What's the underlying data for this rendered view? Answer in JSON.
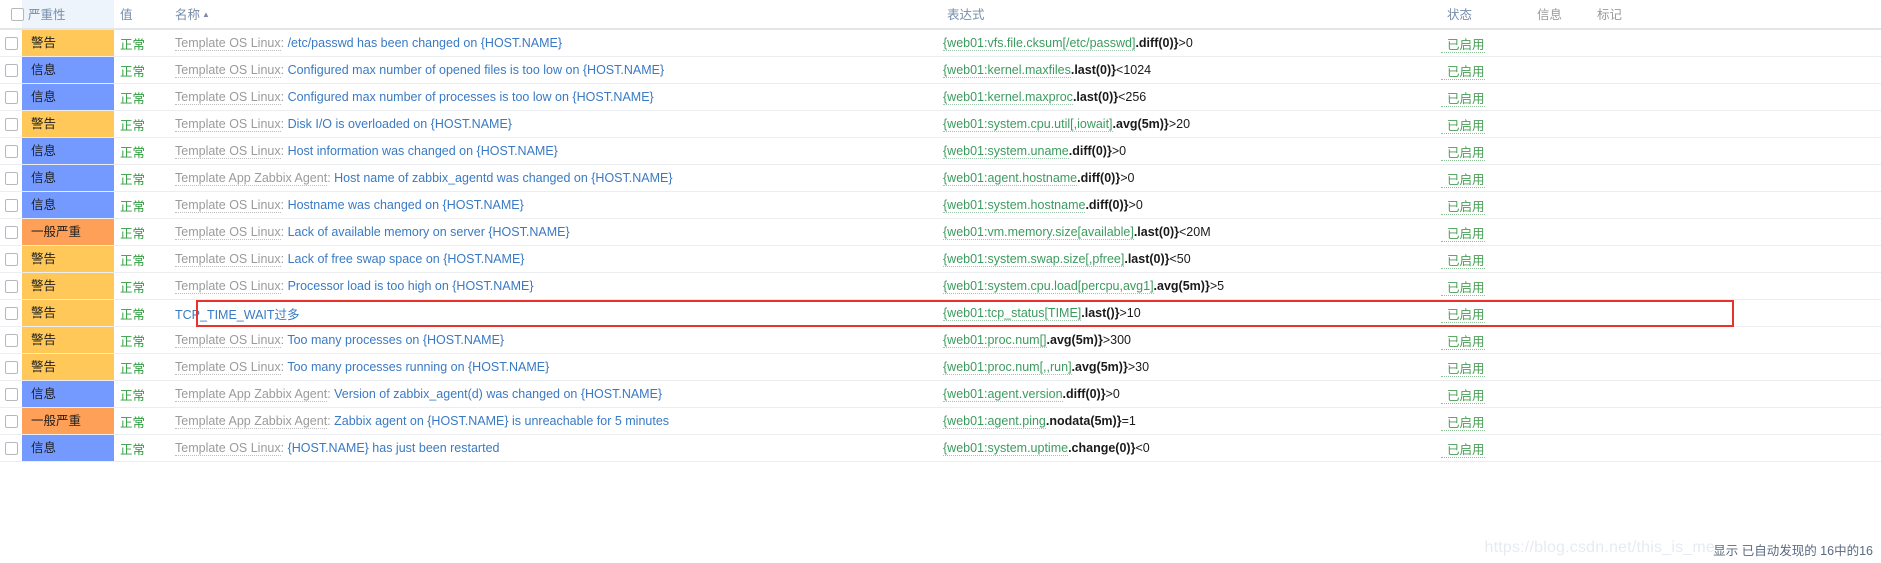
{
  "table": {
    "columns": {
      "severity": "严重性",
      "value": "值",
      "name": "名称",
      "name_sort_arrow": "▲",
      "expression": "表达式",
      "status": "状态",
      "info": "信息",
      "tag": "标记"
    },
    "rows": [
      {
        "severity": "警告",
        "severity_class": "sev-warning",
        "value": "正常",
        "template": "Template OS Linux",
        "trigger": "/etc/passwd has been changed on {HOST.NAME}",
        "expr_key": "{web01:vfs.file.cksum[/etc/passwd]",
        "expr_fn": ".diff(0)}",
        "expr_op": ">0",
        "status": "已启用",
        "info": "",
        "tag": ""
      },
      {
        "severity": "信息",
        "severity_class": "sev-info",
        "value": "正常",
        "template": "Template OS Linux",
        "trigger": "Configured max number of opened files is too low on {HOST.NAME}",
        "expr_key": "{web01:kernel.maxfiles",
        "expr_fn": ".last(0)}",
        "expr_op": "<1024",
        "status": "已启用",
        "info": "",
        "tag": ""
      },
      {
        "severity": "信息",
        "severity_class": "sev-info",
        "value": "正常",
        "template": "Template OS Linux",
        "trigger": "Configured max number of processes is too low on {HOST.NAME}",
        "expr_key": "{web01:kernel.maxproc",
        "expr_fn": ".last(0)}",
        "expr_op": "<256",
        "status": "已启用",
        "info": "",
        "tag": ""
      },
      {
        "severity": "警告",
        "severity_class": "sev-warning",
        "value": "正常",
        "template": "Template OS Linux",
        "trigger": "Disk I/O is overloaded on {HOST.NAME}",
        "expr_key": "{web01:system.cpu.util[,iowait]",
        "expr_fn": ".avg(5m)}",
        "expr_op": ">20",
        "status": "已启用",
        "info": "",
        "tag": ""
      },
      {
        "severity": "信息",
        "severity_class": "sev-info",
        "value": "正常",
        "template": "Template OS Linux",
        "trigger": "Host information was changed on {HOST.NAME}",
        "expr_key": "{web01:system.uname",
        "expr_fn": ".diff(0)}",
        "expr_op": ">0",
        "status": "已启用",
        "info": "",
        "tag": ""
      },
      {
        "severity": "信息",
        "severity_class": "sev-info",
        "value": "正常",
        "template": "Template App Zabbix Agent",
        "trigger": "Host name of zabbix_agentd was changed on {HOST.NAME}",
        "expr_key": "{web01:agent.hostname",
        "expr_fn": ".diff(0)}",
        "expr_op": ">0",
        "status": "已启用",
        "info": "",
        "tag": ""
      },
      {
        "severity": "信息",
        "severity_class": "sev-info",
        "value": "正常",
        "template": "Template OS Linux",
        "trigger": "Hostname was changed on {HOST.NAME}",
        "expr_key": "{web01:system.hostname",
        "expr_fn": ".diff(0)}",
        "expr_op": ">0",
        "status": "已启用",
        "info": "",
        "tag": ""
      },
      {
        "severity": "一般严重",
        "severity_class": "sev-average",
        "value": "正常",
        "template": "Template OS Linux",
        "trigger": "Lack of available memory on server {HOST.NAME}",
        "expr_key": "{web01:vm.memory.size[available]",
        "expr_fn": ".last(0)}",
        "expr_op": "<20M",
        "status": "已启用",
        "info": "",
        "tag": ""
      },
      {
        "severity": "警告",
        "severity_class": "sev-warning",
        "value": "正常",
        "template": "Template OS Linux",
        "trigger": "Lack of free swap space on {HOST.NAME}",
        "expr_key": "{web01:system.swap.size[,pfree]",
        "expr_fn": ".last(0)}",
        "expr_op": "<50",
        "status": "已启用",
        "info": "",
        "tag": ""
      },
      {
        "severity": "警告",
        "severity_class": "sev-warning",
        "value": "正常",
        "template": "Template OS Linux",
        "trigger": "Processor load is too high on {HOST.NAME}",
        "expr_key": "{web01:system.cpu.load[percpu,avg1]",
        "expr_fn": ".avg(5m)}",
        "expr_op": ">5",
        "status": "已启用",
        "info": "",
        "tag": ""
      },
      {
        "severity": "警告",
        "severity_class": "sev-warning",
        "value": "正常",
        "template": "",
        "trigger": "TCP_TIME_WAIT过多",
        "expr_key": "{web01:tcp_status[TIME]",
        "expr_fn": ".last()}",
        "expr_op": ">10",
        "status": "已启用",
        "info": "",
        "tag": "",
        "highlighted": true
      },
      {
        "severity": "警告",
        "severity_class": "sev-warning",
        "value": "正常",
        "template": "Template OS Linux",
        "trigger": "Too many processes on {HOST.NAME}",
        "expr_key": "{web01:proc.num[]",
        "expr_fn": ".avg(5m)}",
        "expr_op": ">300",
        "status": "已启用",
        "info": "",
        "tag": ""
      },
      {
        "severity": "警告",
        "severity_class": "sev-warning",
        "value": "正常",
        "template": "Template OS Linux",
        "trigger": "Too many processes running on {HOST.NAME}",
        "expr_key": "{web01:proc.num[,,run]",
        "expr_fn": ".avg(5m)}",
        "expr_op": ">30",
        "status": "已启用",
        "info": "",
        "tag": ""
      },
      {
        "severity": "信息",
        "severity_class": "sev-info",
        "value": "正常",
        "template": "Template App Zabbix Agent",
        "trigger": "Version of zabbix_agent(d) was changed on {HOST.NAME}",
        "expr_key": "{web01:agent.version",
        "expr_fn": ".diff(0)}",
        "expr_op": ">0",
        "status": "已启用",
        "info": "",
        "tag": ""
      },
      {
        "severity": "一般严重",
        "severity_class": "sev-average",
        "value": "正常",
        "template": "Template App Zabbix Agent",
        "trigger": "Zabbix agent on {HOST.NAME} is unreachable for 5 minutes",
        "expr_key": "{web01:agent.ping",
        "expr_fn": ".nodata(5m)}",
        "expr_op": "=1",
        "status": "已启用",
        "info": "",
        "tag": ""
      },
      {
        "severity": "信息",
        "severity_class": "sev-info",
        "value": "正常",
        "template": "Template OS Linux",
        "trigger": "{HOST.NAME} has just been restarted",
        "expr_key": "{web01:system.uptime",
        "expr_fn": ".change(0)}",
        "expr_op": "<0",
        "status": "已启用",
        "info": "",
        "tag": ""
      }
    ]
  },
  "footer": {
    "text": "显示 已自动发现的 16中的16",
    "watermark": "https://blog.csdn.net/this_is_me"
  }
}
